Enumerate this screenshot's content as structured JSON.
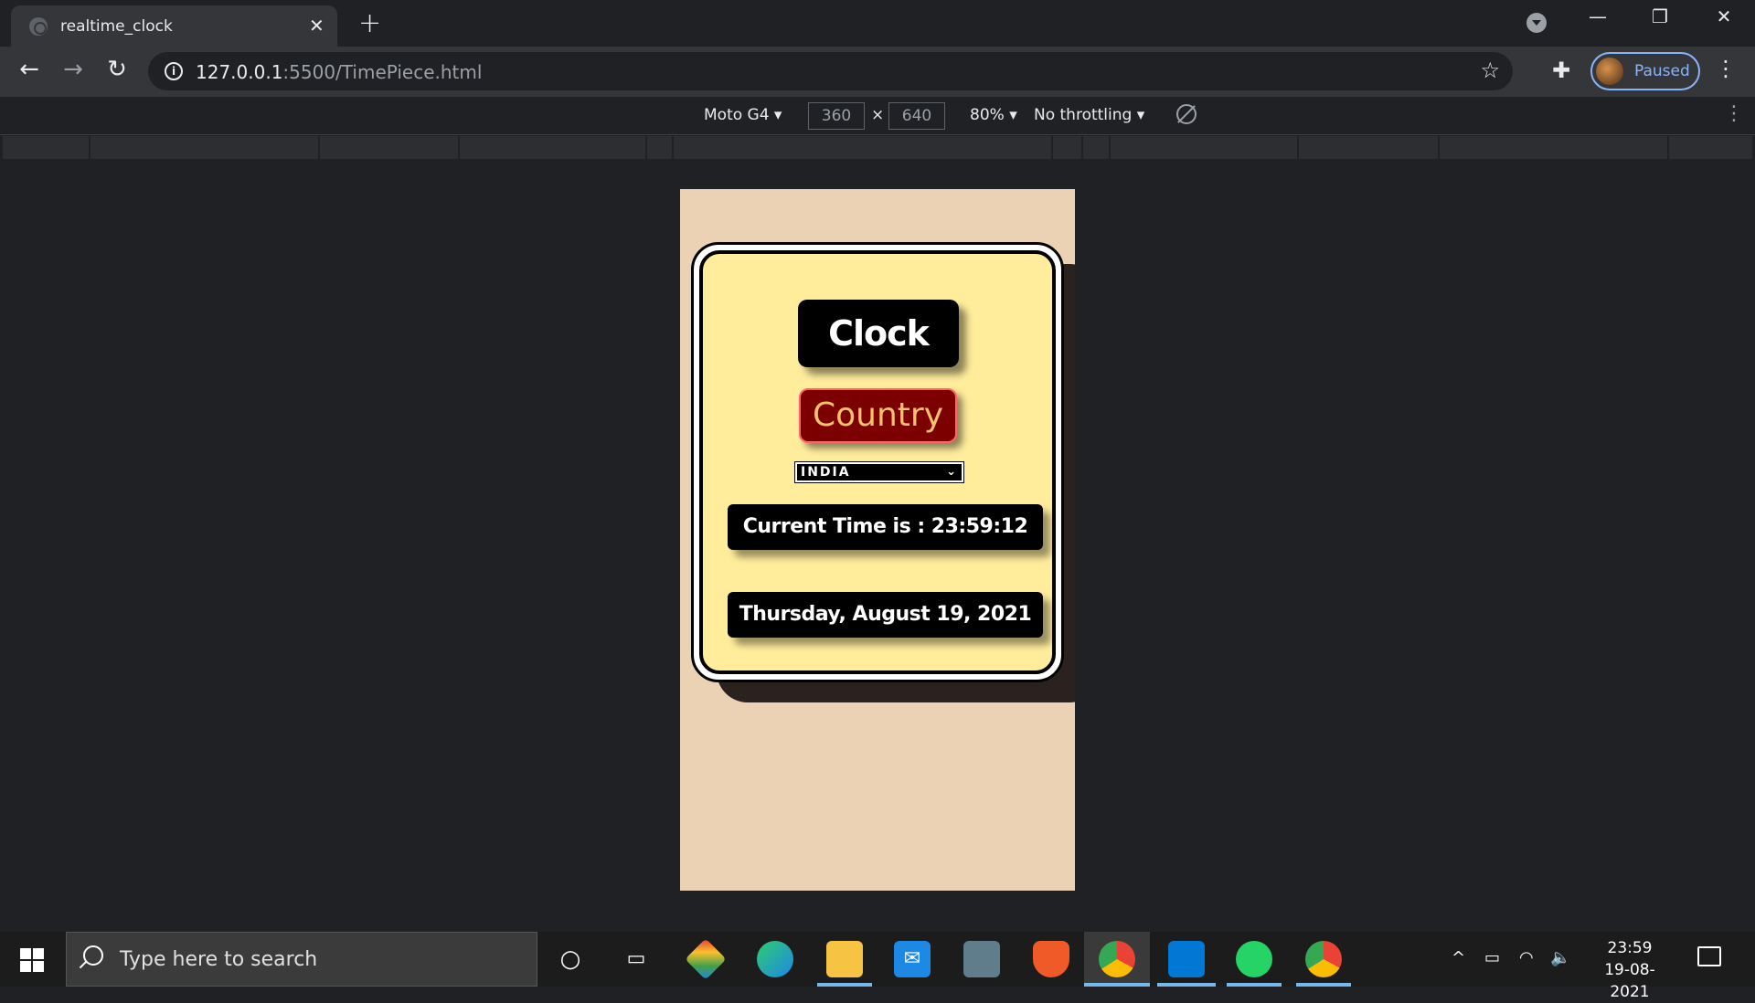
{
  "browser": {
    "tab_title": "realtime_clock",
    "url_host": "127.0.0.1",
    "url_rest": ":5500/TimePiece.html",
    "profile_label": "Paused"
  },
  "devtools": {
    "device": "Moto G4",
    "width": "360",
    "height": "640",
    "times": "×",
    "zoom": "80%",
    "throttling": "No throttling"
  },
  "page": {
    "clock_title": "Clock",
    "country_title": "Country",
    "country_selected": "INDIA",
    "current_time": "Current Time is : 23:59:12",
    "date": "Thursday, August 19, 2021"
  },
  "taskbar": {
    "search_placeholder": "Type here to search",
    "time": "23:59",
    "date": "19-08-2021"
  },
  "colors": {
    "page_bg": "#ebd2b4",
    "card_bg": "#ffed9c",
    "country_bg": "#7d0000",
    "country_text": "#f5c16c"
  }
}
